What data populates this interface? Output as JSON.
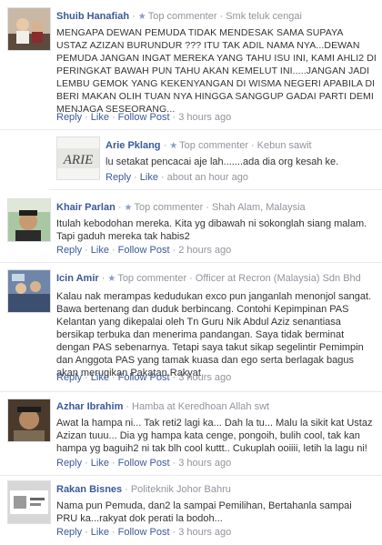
{
  "comments": [
    {
      "name": "Shuib Hanafiah",
      "badge": "Top commenter",
      "role": "Smk teluk cengai",
      "text": "MENGAPA DEWAN PEMUDA TIDAK MENDESAK SAMA SUPAYA USTAZ AZIZAN BURUNDUR ??? ITU TAK ADIL NAMA NYA...DEWAN PEMUDA JANGAN INGAT MEREKA YANG TAHU ISU INI, KAMI AHLI2 DI PERINGKAT BAWAH PUN TAHU AKAN KEMELUT INI.....JANGAN JADI LEMBU GEMOK YANG KEKENYANGAN DI WISMA NEGERI APABILA DI BERI MAKAN OLIH TUAN NYA HINGGA SANGGUP GADAI PARTI DEMI MENJAGA SESEORANG...",
      "reply": "Reply",
      "like": "Like",
      "follow": "Follow Post",
      "time": "3 hours ago"
    },
    {
      "name": "Arie Pklang",
      "badge": "Top commenter",
      "role": "Kebun sawit",
      "text": "lu setakat pencacai aje lah.......ada dia org kesah ke.",
      "reply": "Reply",
      "like": "Like",
      "time": "about an hour ago",
      "avatar_text": "ARIE"
    },
    {
      "name": "Khair Parlan",
      "badge": "Top commenter",
      "role": "Shah Alam, Malaysia",
      "text": "Itulah kebodohan mereka. Kita yg dibawah ni sokonglah siang malam. Tapi gaduh mereka tak habis2",
      "reply": "Reply",
      "like": "Like",
      "follow": "Follow Post",
      "time": "2 hours ago"
    },
    {
      "name": "Icin Amir",
      "badge": "Top commenter",
      "role": "Officer at Recron (Malaysia) Sdn Bhd",
      "text": "Kalau nak merampas kedudukan exco pun janganlah menonjol sangat. Bawa bertenang dan duduk berbincang. Contohi Kepimpinan PAS Kelantan yang dikepalai oleh Tn Guru Nik Abdul Aziz senantiasa bersikap terbuka dan menerima pandangan. Saya tidak berminat dengan PAS sebenarnya. Tetapi saya takut sikap segelintir Pemimpin dan Anggota PAS yang tamak kuasa dan ego serta berlagak bagus akan merugikan Pakatan Rakyat.",
      "reply": "Reply",
      "like": "Like",
      "follow": "Follow Post",
      "time": "3 hours ago"
    },
    {
      "name": "Azhar Ibrahim",
      "badge": "",
      "role": "Hamba at Keredhoan Allah swt",
      "text": "Awat la hampa ni... Tak reti2 lagi ka... Dah la tu... Malu la sikit kat Ustaz Azizan tuuu... Dia yg hampa kata cenge, pongoih, bulih cool, tak kan hampa yg baguih2 ni tak blh cool kuttt.. Cukuplah ooiiii, letih la lagu ni!",
      "reply": "Reply",
      "like": "Like",
      "follow": "Follow Post",
      "time": "3 hours ago"
    },
    {
      "name": "Rakan Bisnes",
      "badge": "",
      "role": "Politeknik Johor Bahru",
      "text": "Nama pun Pemuda, dan2 la sampai Pemilihan, Bertahanla sampai PRU ka...rakyat dok perati la bodoh...",
      "reply": "Reply",
      "like": "Like",
      "follow": "Follow Post",
      "time": "3 hours ago"
    }
  ],
  "colors": {
    "link": "#3b5998",
    "meta": "#90949c",
    "text": "#333333",
    "divider": "#e9eaed"
  },
  "icons": {
    "badge": "star-icon"
  }
}
